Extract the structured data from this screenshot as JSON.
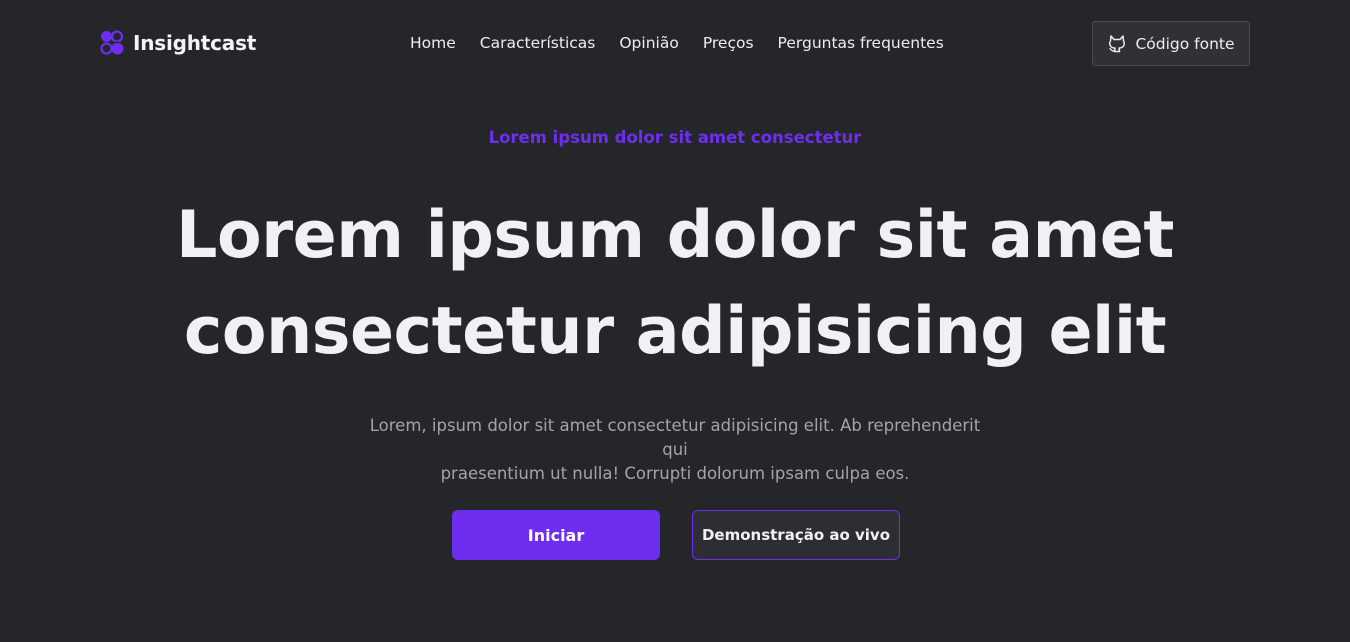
{
  "brand": {
    "name": "Insightcast",
    "accent_color": "#6d2ef0",
    "logo_icon": "overlapping-shapes-logo"
  },
  "nav": {
    "items": [
      {
        "label": "Home"
      },
      {
        "label": "Características"
      },
      {
        "label": "Opinião"
      },
      {
        "label": "Preços"
      },
      {
        "label": "Perguntas frequentes"
      }
    ]
  },
  "source_button": {
    "label": "Código fonte",
    "icon": "github-icon"
  },
  "hero": {
    "eyebrow": "Lorem ipsum dolor sit amet consectetur",
    "headline_line1": "Lorem ipsum dolor sit amet",
    "headline_line2": "consectetur adipisicing elit",
    "subtitle_line1": "Lorem, ipsum dolor sit amet consectetur adipisicing elit. Ab reprehenderit qui",
    "subtitle_line2": "praesentium ut nulla! Corrupti dolorum ipsam culpa eos.",
    "primary_cta": "Iniciar",
    "secondary_cta": "Demonstração ao vivo"
  },
  "colors": {
    "background": "#252629",
    "text": "#f1f1f3",
    "muted_text": "#a3a4aa",
    "accent": "#6d2ef0"
  }
}
